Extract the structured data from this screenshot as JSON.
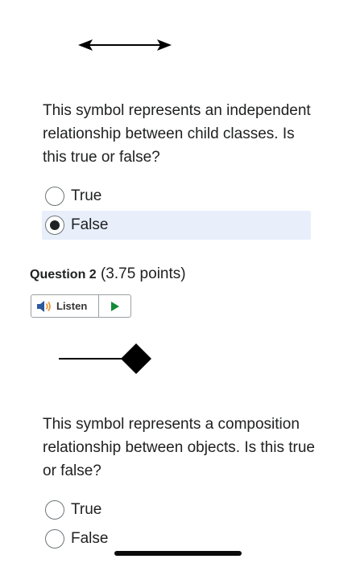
{
  "q1": {
    "symbol_icon": "double-arrow-icon",
    "text": "This symbol represents an independent relationship between child classes. Is this true or false?",
    "options": [
      {
        "label": "True",
        "checked": false
      },
      {
        "label": "False",
        "checked": true
      }
    ]
  },
  "q2": {
    "title": "Question 2",
    "points": "(3.75 points)",
    "listen_label": "Listen",
    "listen_icon": "speaker-icon",
    "play_icon": "play-icon",
    "symbol_icon": "composition-diamond-icon",
    "text": "This symbol represents a composition relationship between objects. Is this true or false?",
    "options": [
      {
        "label": "True",
        "checked": false
      },
      {
        "label": "False",
        "checked": false
      }
    ]
  },
  "colors": {
    "selected_bg": "#e8effb",
    "text": "#202122",
    "play_green": "#138a36",
    "speaker_blue": "#2c5aa0",
    "speaker_orange": "#e9932b"
  }
}
